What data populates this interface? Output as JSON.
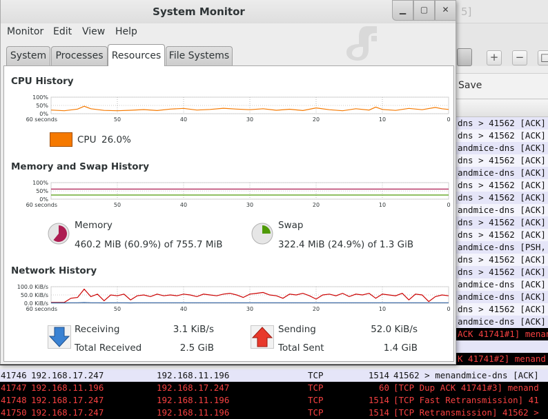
{
  "background": {
    "title_fragment": "5]",
    "save_label": "Save",
    "rows": [
      {
        "kind": "ack",
        "text": "dns > 41562 [ACK]"
      },
      {
        "kind": "ack",
        "text": "dns > 41562 [ACK]"
      },
      {
        "kind": "ack",
        "text": "andmice-dns [ACK]"
      },
      {
        "kind": "ack",
        "text": "dns > 41562 [ACK]"
      },
      {
        "kind": "ack",
        "text": "andmice-dns [ACK]"
      },
      {
        "kind": "ack",
        "text": "dns > 41562 [ACK]"
      },
      {
        "kind": "ack",
        "text": "dns > 41562 [ACK]"
      },
      {
        "kind": "ack",
        "text": "andmice-dns [ACK]"
      },
      {
        "kind": "ack",
        "text": "dns > 41562 [ACK]"
      },
      {
        "kind": "ack",
        "text": "dns > 41562 [ACK]"
      },
      {
        "kind": "ack",
        "text": "andmice-dns [PSH,"
      },
      {
        "kind": "ack",
        "text": "dns > 41562 [ACK]"
      },
      {
        "kind": "ack",
        "text": "dns > 41562 [ACK]"
      },
      {
        "kind": "ack",
        "text": "andmice-dns [ACK]"
      },
      {
        "kind": "ack",
        "text": "andmice-dns [ACK]"
      },
      {
        "kind": "ack",
        "text": "dns > 41562 [ACK]"
      },
      {
        "kind": "ack",
        "text": "andmice-dns [ACK]"
      },
      {
        "kind": "bad",
        "text": "ACK 41741#1] menand"
      },
      {
        "kind": "ack",
        "text": ""
      },
      {
        "kind": "bad",
        "text": "K 41741#2] menand"
      }
    ],
    "full_rows": [
      {
        "kind": "sel",
        "no": "41746",
        "src": "192.168.17.247",
        "dst": "192.168.11.196",
        "proto": "TCP",
        "len": "1514",
        "info": "41562 > menandmice-dns [ACK]"
      },
      {
        "kind": "bad",
        "no": "41747",
        "src": "192.168.11.196",
        "dst": "192.168.17.247",
        "proto": "TCP",
        "len": "60",
        "info": "[TCP Dup ACK 41741#3] menand"
      },
      {
        "kind": "bad",
        "no": "41748",
        "src": "192.168.17.247",
        "dst": "192.168.11.196",
        "proto": "TCP",
        "len": "1514",
        "info": "[TCP Fast Retransmission] 41"
      },
      {
        "kind": "bad",
        "no": "41750",
        "src": "192.168.17.247",
        "dst": "192.168.11.196",
        "proto": "TCP",
        "len": "1514",
        "info": "[TCP Retransmission] 41562 >"
      }
    ]
  },
  "window": {
    "title": "System Monitor",
    "menu": [
      "Monitor",
      "Edit",
      "View",
      "Help"
    ],
    "tabs": [
      {
        "label": "System",
        "active": false
      },
      {
        "label": "Processes",
        "active": false
      },
      {
        "label": "Resources",
        "active": true
      },
      {
        "label": "File Systems",
        "active": false
      }
    ]
  },
  "axis": {
    "x_ticks": [
      "60 seconds",
      "50",
      "40",
      "30",
      "20",
      "10",
      "0"
    ]
  },
  "cpu": {
    "title": "CPU History",
    "y_ticks": [
      "100%",
      "50%",
      "0%"
    ],
    "legend_label": "CPU",
    "legend_value": "26.0%",
    "color": "#f57900",
    "chart_data": {
      "type": "line",
      "x": [
        60,
        58,
        56,
        55,
        54,
        52,
        50,
        48,
        46,
        44,
        42,
        40,
        38,
        36,
        34,
        32,
        30,
        28,
        26,
        24,
        22,
        20,
        18,
        16,
        14,
        12,
        11,
        10,
        8,
        6,
        4,
        2,
        1,
        0
      ],
      "values": [
        22,
        18,
        28,
        45,
        30,
        20,
        18,
        21,
        25,
        19,
        28,
        32,
        22,
        26,
        33,
        28,
        24,
        30,
        21,
        27,
        19,
        35,
        24,
        18,
        30,
        22,
        40,
        26,
        20,
        32,
        24,
        38,
        30,
        26
      ],
      "ylim": [
        0,
        100
      ]
    }
  },
  "memory": {
    "title": "Memory and Swap History",
    "y_ticks": [
      "100%",
      "50%",
      "0%"
    ],
    "mem_label": "Memory",
    "mem_value": "460.2 MiB (60.9%) of 755.7 MiB",
    "mem_color": "#ad1d52",
    "swap_label": "Swap",
    "swap_value": "322.4 MiB (24.9%) of 1.3 GiB",
    "swap_color": "#4e9a06",
    "chart_data": {
      "type": "line",
      "x": [
        60,
        0
      ],
      "series": [
        {
          "values": [
            60.9,
            60.9
          ]
        },
        {
          "values": [
            24.9,
            24.9
          ]
        }
      ],
      "ylim": [
        0,
        100
      ],
      "memory_fraction": 0.609,
      "swap_fraction": 0.249
    }
  },
  "network": {
    "title": "Network History",
    "y_ticks": [
      "100.0 KiB/s",
      "50.0 KiB/s",
      "0.0 KiB/s"
    ],
    "receiving_label": "Receiving",
    "receiving_value": "3.1 KiB/s",
    "total_received_label": "Total Received",
    "total_received_value": "2.5 GiB",
    "sending_label": "Sending",
    "sending_value": "52.0 KiB/s",
    "total_sent_label": "Total Sent",
    "total_sent_value": "1.4 GiB",
    "recv_color": "#3465a4",
    "send_color": "#cc0000",
    "chart_data": {
      "type": "line",
      "x": [
        60,
        58,
        57,
        56,
        55,
        54,
        53,
        52,
        51,
        50,
        49,
        48,
        47,
        46,
        45,
        44,
        43,
        42,
        41,
        40,
        39,
        38,
        37,
        36,
        35,
        34,
        33,
        32,
        31,
        30,
        29,
        28,
        27,
        26,
        25,
        24,
        23,
        22,
        21,
        20,
        19,
        18,
        17,
        16,
        15,
        14,
        13,
        12,
        11,
        10,
        9,
        8,
        7,
        6,
        5,
        4,
        3,
        2,
        1,
        0
      ],
      "series": [
        {
          "values": [
            5,
            5,
            30,
            35,
            85,
            40,
            55,
            15,
            50,
            45,
            55,
            20,
            45,
            50,
            40,
            55,
            45,
            50,
            45,
            55,
            50,
            40,
            55,
            50,
            45,
            55,
            60,
            50,
            35,
            55,
            60,
            65,
            50,
            45,
            30,
            55,
            50,
            60,
            45,
            25,
            50,
            55,
            45,
            60,
            40,
            55,
            50,
            60,
            30,
            55,
            50,
            45,
            60,
            20,
            55,
            50,
            10,
            40,
            50,
            45
          ]
        },
        {
          "values": [
            2,
            2,
            3,
            3,
            4,
            3,
            3,
            2,
            3,
            3,
            3,
            2,
            3,
            3,
            3,
            3,
            3,
            3,
            3,
            3,
            3,
            3,
            3,
            3,
            3,
            3,
            3,
            3,
            3,
            3,
            3,
            3,
            3,
            3,
            3,
            3,
            3,
            3,
            3,
            3,
            3,
            3,
            3,
            3,
            3,
            3,
            3,
            3,
            3,
            3,
            3,
            3,
            3,
            3,
            3,
            3,
            3,
            3,
            3,
            3
          ]
        }
      ],
      "ylim": [
        0,
        100
      ]
    }
  }
}
